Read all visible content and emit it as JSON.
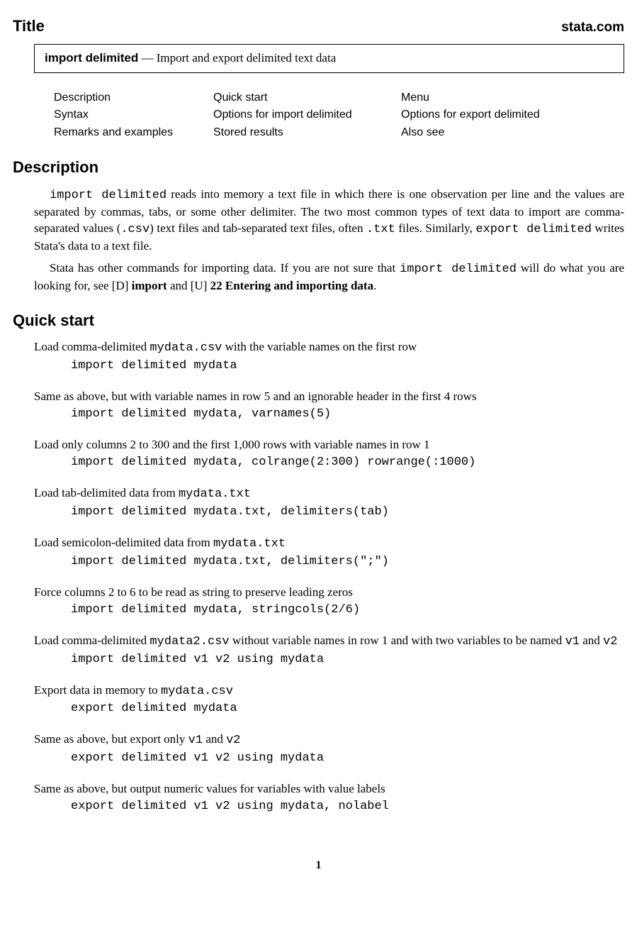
{
  "header": {
    "title": "Title",
    "site": "stata.com"
  },
  "box": {
    "command": "import delimited",
    "sep": " — ",
    "desc": "Import and export delimited text data"
  },
  "toc": {
    "r1c1": "Description",
    "r1c2": "Quick start",
    "r1c3": "Menu",
    "r2c1": "Syntax",
    "r2c2": "Options for import delimited",
    "r2c3": "Options for export delimited",
    "r3c1": "Remarks and examples",
    "r3c2": "Stored results",
    "r3c3": "Also see"
  },
  "sections": {
    "description": "Description",
    "quickstart": "Quick start"
  },
  "desc": {
    "p1a": "import delimited",
    "p1b": " reads into memory a text file in which there is one observation per line and the values are separated by commas, tabs, or some other delimiter. The two most common types of text data to import are comma-separated values (",
    "p1c": ".csv",
    "p1d": ") text files and tab-separated text files, often ",
    "p1e": ".txt",
    "p1f": " files. Similarly, ",
    "p1g": "export delimited",
    "p1h": " writes Stata's data to a text file.",
    "p2a": "Stata has other commands for importing data. If you are not sure that ",
    "p2b": "import delimited",
    "p2c": " will do what you are looking for, see ",
    "p2d": "[D]",
    "p2e": " import",
    "p2f": " and ",
    "p2g": "[U]",
    "p2h": " 22 Entering and importing data",
    "p2i": "."
  },
  "qs": [
    {
      "segs": [
        "Load comma-delimited ",
        "mydata.csv",
        " with the variable names on the first row"
      ],
      "code": "import delimited mydata"
    },
    {
      "segs": [
        "Same as above, but with variable names in row 5 and an ignorable header in the first 4 rows"
      ],
      "code": "import delimited mydata, varnames(5)"
    },
    {
      "segs": [
        "Load only columns 2 to 300 and the first 1,000 rows with variable names in row 1"
      ],
      "code": "import delimited mydata, colrange(2:300) rowrange(:1000)"
    },
    {
      "segs": [
        "Load tab-delimited data from ",
        "mydata.txt"
      ],
      "code": "import delimited mydata.txt, delimiters(tab)"
    },
    {
      "segs": [
        "Load semicolon-delimited data from ",
        "mydata.txt"
      ],
      "code": "import delimited mydata.txt, delimiters(\";\")"
    },
    {
      "segs": [
        "Force columns 2 to 6 to be read as string to preserve leading zeros"
      ],
      "code": "import delimited mydata, stringcols(2/6)"
    },
    {
      "segs": [
        "Load comma-delimited ",
        "mydata2.csv",
        " without variable names in row 1 and with two variables to be named ",
        "v1",
        " and ",
        "v2"
      ],
      "code": "import delimited v1 v2 using mydata"
    },
    {
      "segs": [
        "Export data in memory to ",
        "mydata.csv"
      ],
      "code": "export delimited mydata"
    },
    {
      "segs": [
        "Same as above, but export only ",
        "v1",
        " and ",
        "v2"
      ],
      "code": "export delimited v1 v2 using mydata"
    },
    {
      "segs": [
        "Same as above, but output numeric values for variables with value labels"
      ],
      "code": "export delimited v1 v2 using mydata, nolabel"
    }
  ],
  "page_number": "1"
}
